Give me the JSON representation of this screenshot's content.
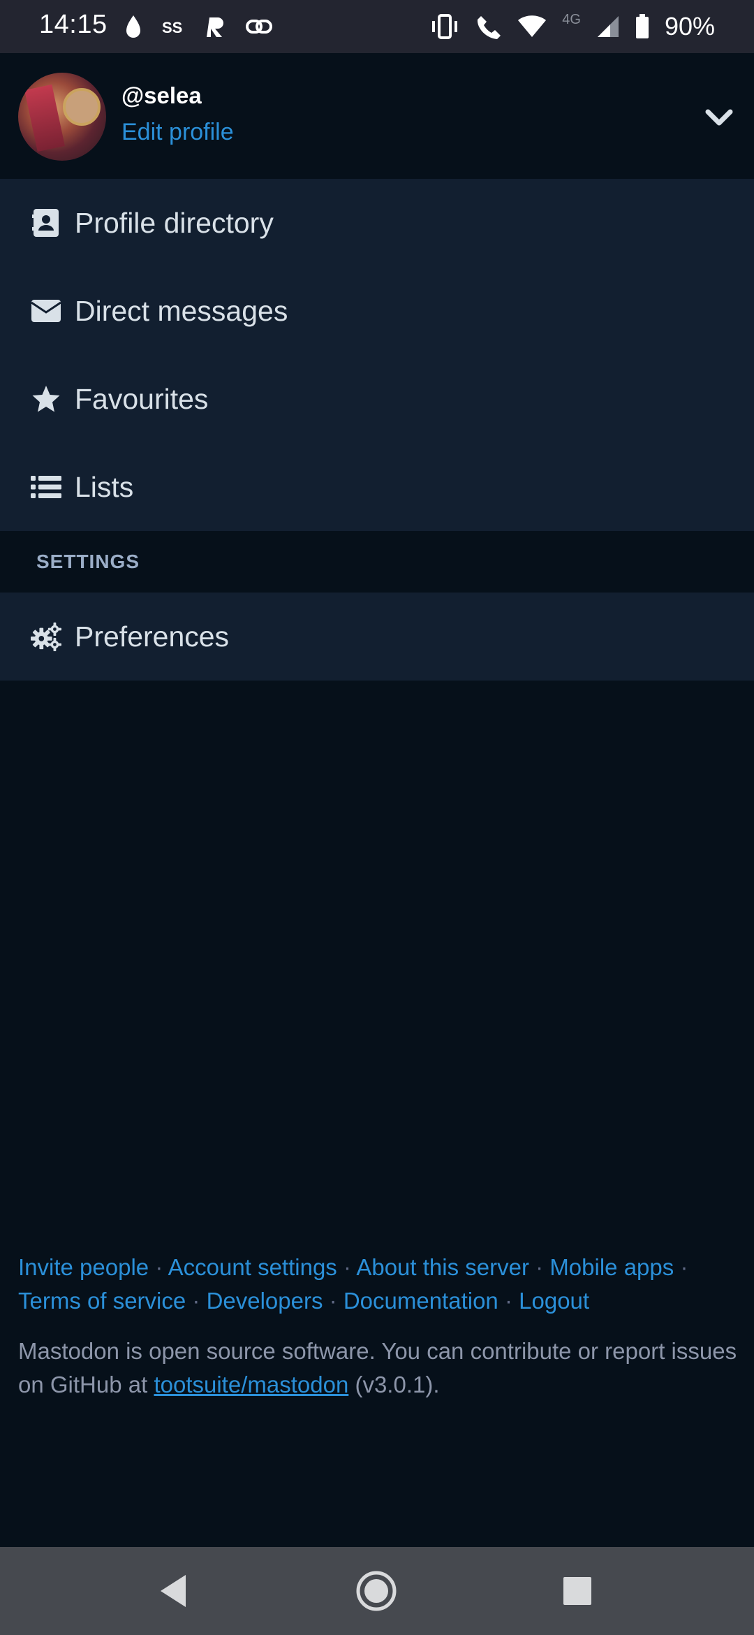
{
  "status_bar": {
    "time": "14:15",
    "network_label": "4G",
    "battery_percent": "90%"
  },
  "header": {
    "username": "@selea",
    "edit_profile_label": "Edit profile"
  },
  "menu": {
    "items": [
      {
        "label": "Profile directory",
        "icon": "address-card-icon"
      },
      {
        "label": "Direct messages",
        "icon": "envelope-icon"
      },
      {
        "label": "Favourites",
        "icon": "star-icon"
      },
      {
        "label": "Lists",
        "icon": "list-icon"
      }
    ]
  },
  "settings": {
    "section_label": "SETTINGS",
    "items": [
      {
        "label": "Preferences",
        "icon": "gears-icon"
      }
    ]
  },
  "footer": {
    "links": {
      "invite": "Invite people",
      "account_settings": "Account settings",
      "about_server": "About this server",
      "mobile_apps": "Mobile apps",
      "terms": "Terms of service",
      "developers": "Developers",
      "documentation": "Documentation",
      "logout": "Logout"
    },
    "separator": "·",
    "about_prefix": "Mastodon is open source software. You can contribute or report issues on GitHub at ",
    "repo_link": "tootsuite/mastodon",
    "version": "(v3.0.1)."
  },
  "colors": {
    "accent": "#2b90d9",
    "background": "#06101a",
    "menu_bg": "#121f30"
  }
}
